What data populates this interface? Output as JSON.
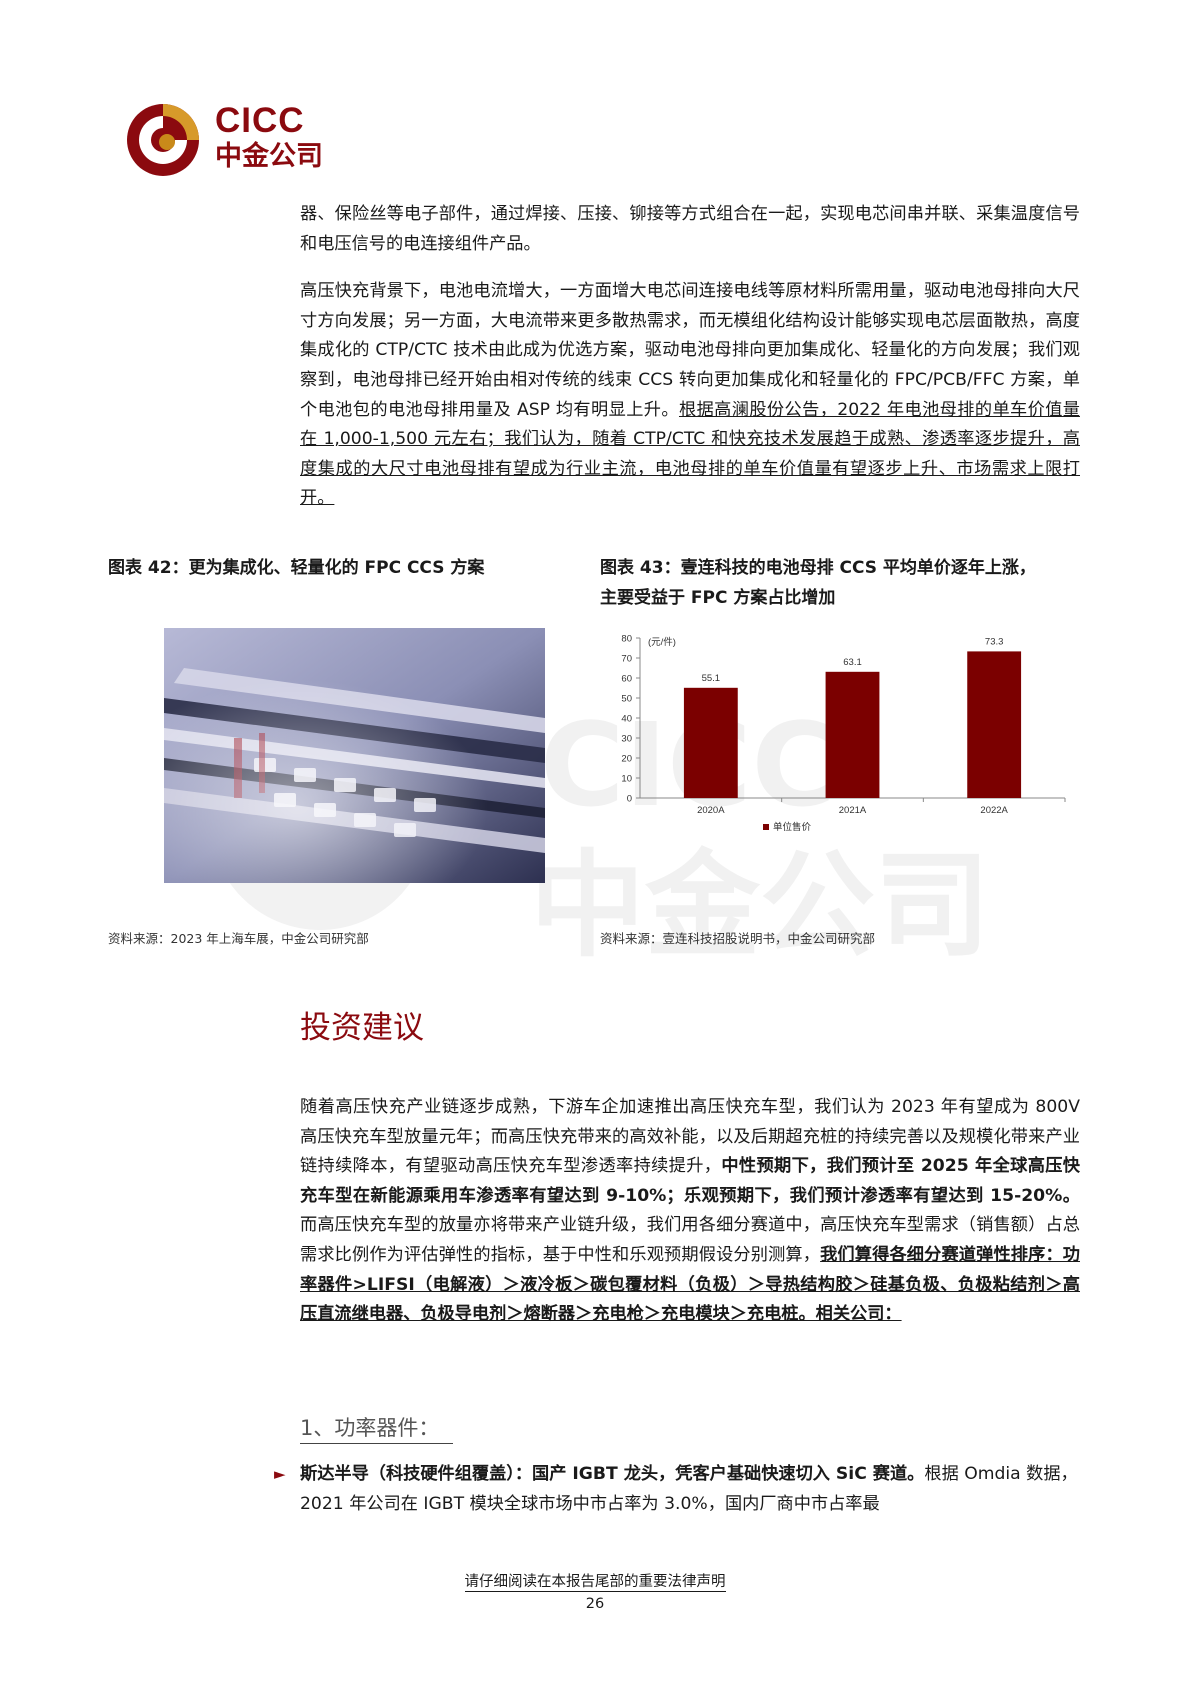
{
  "header": {
    "logo_en": "CICC",
    "logo_cn": "中金公司"
  },
  "watermark": {
    "en": "CICC",
    "cn": "中金公司"
  },
  "intro": {
    "p1": "器、保险丝等电子部件，通过焊接、压接、铆接等方式组合在一起，实现电芯间串并联、采集温度信号和电压信号的电连接组件产品。",
    "p2_plain": "高压快充背景下，电池电流增大，一方面增大电芯间连接电线等原材料所需用量，驱动电池母排向大尺寸方向发展；另一方面，大电流带来更多散热需求，而无模组化结构设计能够实现电芯层面散热，高度集成化的 CTP/CTC 技术由此成为优选方案，驱动电池母排向更加集成化、轻量化的方向发展；我们观察到，电池母排已经开始由相对传统的线束 CCS 转向更加集成化和轻量化的 FPC/PCB/FFC 方案，单个电池包的电池母排用量及 ASP 均有明显上升。",
    "p2_underlined": "根据高澜股份公告，2022 年电池母排的单车价值量在 1,000-1,500 元左右；我们认为，随着 CTP/CTC 和快充技术发展趋于成熟、渗透率逐步提升，高度集成的大尺寸电池母排有望成为行业主流，电池母排的单车价值量有望逐步上升、市场需求上限打开。"
  },
  "figure42": {
    "title": "图表 42：更为集成化、轻量化的 FPC CCS 方案",
    "source": "资料来源：2023 年上海车展，中金公司研究部"
  },
  "figure43": {
    "title_line1": "图表 43：壹连科技的电池母排 CCS 平均单价逐年上涨，",
    "title_line2": "主要受益于 FPC 方案占比增加",
    "source": "资料来源：壹连科技招股说明书，中金公司研究部"
  },
  "chart_data": {
    "type": "bar",
    "categories": [
      "2020A",
      "2021A",
      "2022A"
    ],
    "values": [
      55.1,
      63.1,
      73.3
    ],
    "value_labels": [
      "55.1",
      "63.1",
      "73.3"
    ],
    "unit_label": "(元/件)",
    "legend": "单位售价",
    "legend_position": "bottom-left",
    "ylim": [
      0,
      80
    ],
    "yticks": [
      0,
      10,
      20,
      30,
      40,
      50,
      60,
      70,
      80
    ],
    "grid": false,
    "bar_color": "#7b0000"
  },
  "investment": {
    "title": "投资建议",
    "p_plain": "随着高压快充产业链逐步成熟，下游车企加速推出高压快充车型，我们认为 2023 年有望成为 800V 高压快充车型放量元年；而高压快充带来的高效补能，以及后期超充桩的持续完善以及规模化带来产业链持续降本，有望驱动高压快充车型渗透率持续提升，",
    "p_bold": "中性预期下，我们预计至 2025 年全球高压快充车型在新能源乘用车渗透率有望达到 9-10%；乐观预期下，我们预计渗透率有望达到 15-20%。",
    "p_plain2": "而高压快充车型的放量亦将带来产业链升级，我们用各细分赛道中，高压快充车型需求（销售额）占总需求比例作为评估弹性的指标，基于中性和乐观预期假设分别测算，",
    "p_bold_underlined": "我们算得各细分赛道弹性排序：功率器件>LIFSI（电解液）＞液冷板＞碳包覆材料（负极）＞导热结构胶＞硅基负极、负极粘结剂＞高压直流继电器、负极导电剂＞熔断器＞充电枪＞充电模块＞充电桩。相关公司："
  },
  "power_devices": {
    "title": "1、功率器件：",
    "bullet_marker": "►",
    "bullet_bold": "斯达半导（科技硬件组覆盖）：国产 IGBT 龙头，凭客户基础快速切入 SiC 赛道。",
    "bullet_plain": "根据 Omdia 数据，2021 年公司在 IGBT 模块全球市场中市占率为 3.0%，国内厂商中市占率最"
  },
  "footer": {
    "note": "请仔细阅读在本报告尾部的重要法律声明",
    "page": "26"
  }
}
